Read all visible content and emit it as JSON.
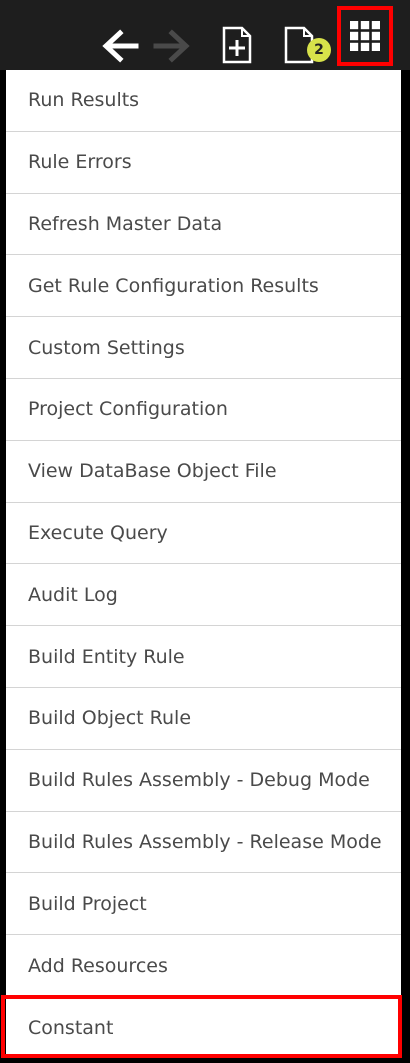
{
  "toolbar": {
    "icons": [
      "back-arrow-icon",
      "forward-arrow-icon",
      "new-document-icon",
      "document-icon",
      "grid-menu-icon"
    ],
    "badge_count": "2"
  },
  "menu": {
    "items": [
      {
        "label": "Run Results"
      },
      {
        "label": "Rule Errors"
      },
      {
        "label": "Refresh Master Data"
      },
      {
        "label": "Get Rule Configuration Results"
      },
      {
        "label": "Custom Settings"
      },
      {
        "label": "Project Configuration"
      },
      {
        "label": "View DataBase Object File"
      },
      {
        "label": "Execute Query"
      },
      {
        "label": "Audit Log"
      },
      {
        "label": "Build Entity Rule"
      },
      {
        "label": "Build Object Rule"
      },
      {
        "label": "Build Rules Assembly - Debug Mode"
      },
      {
        "label": "Build Rules Assembly - Release Mode"
      },
      {
        "label": "Build Project"
      },
      {
        "label": "Add Resources"
      },
      {
        "label": "Constant"
      }
    ]
  },
  "colors": {
    "toolbar_bg": "#1e1e1e",
    "menu_bg": "#ffffff",
    "menu_text": "#4a4a4a",
    "highlight": "#ff0000",
    "badge_bg": "#d7e24a"
  }
}
